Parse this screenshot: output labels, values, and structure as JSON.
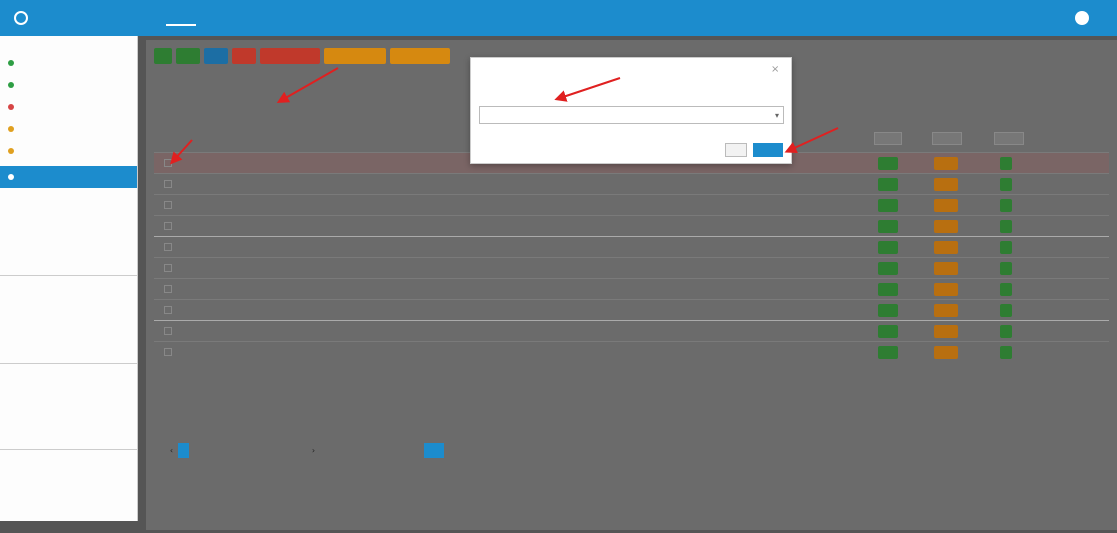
{
  "app": {
    "title": ""
  },
  "topbar": {
    "menu": [
      {
        "label": ""
      },
      {
        "label": ""
      },
      {
        "label": ""
      },
      {
        "label": ""
      },
      {
        "label": ""
      }
    ],
    "user": ""
  },
  "sidebar": {
    "header": "",
    "items": [
      {
        "label": "",
        "color": "#2e9e44"
      },
      {
        "label": "",
        "color": "#2e9e44"
      },
      {
        "label": "",
        "color": "#d64545"
      },
      {
        "label": "",
        "color": "#e0a020"
      },
      {
        "label": "",
        "color": "#e0a020"
      },
      {
        "label": "",
        "color": "#ffffff"
      }
    ],
    "subitems": [
      {
        "label": ""
      },
      {
        "label": ""
      },
      {
        "label": ""
      },
      {
        "label": ""
      },
      {
        "label": ""
      },
      {
        "label": ""
      },
      {
        "label": ""
      },
      {
        "label": ""
      },
      {
        "label": ""
      },
      {
        "label": ""
      },
      {
        "label": ""
      },
      {
        "label": ""
      },
      {
        "label": ""
      },
      {
        "label": ""
      },
      {
        "label": ""
      }
    ]
  },
  "toolbar": {
    "buttons": [
      {
        "label": "",
        "color": "#2e7d32"
      },
      {
        "label": "",
        "color": "#2e7d32"
      },
      {
        "label": "",
        "color": "#1c6ea4"
      },
      {
        "label": "",
        "color": "#c0392b"
      },
      {
        "label": "",
        "color": "#c0392b"
      },
      {
        "label": "",
        "color": "#d68910"
      },
      {
        "label": "",
        "color": "#d68910"
      }
    ]
  },
  "list": {
    "title": "",
    "actions": ""
  },
  "table": {
    "headers": [
      "",
      "",
      "",
      "",
      "",
      "",
      "",
      ""
    ],
    "filters": [
      "",
      "",
      ""
    ],
    "rows": [
      {
        "name": "",
        "date": "",
        "owner": "",
        "flag": "",
        "last": ""
      },
      {
        "name": "",
        "date": "",
        "owner": "",
        "flag": "",
        "last": ""
      },
      {
        "name": "",
        "date": "",
        "owner": "",
        "flag": "",
        "last": ""
      },
      {
        "name": "",
        "date": "",
        "owner": "",
        "flag": "",
        "last": ""
      },
      {
        "name": "",
        "date": "",
        "owner": "",
        "flag": "",
        "last": ""
      },
      {
        "name": "",
        "date": "",
        "owner": "",
        "flag": "",
        "last": ""
      },
      {
        "name": "",
        "date": "",
        "owner": "",
        "flag": "",
        "last": ""
      },
      {
        "name": "",
        "date": "",
        "owner": "",
        "flag": "",
        "last": ""
      },
      {
        "name": "",
        "date": "",
        "owner": "",
        "flag": "",
        "last": ""
      },
      {
        "name": "",
        "date": "",
        "owner": "",
        "flag": "",
        "last": ""
      }
    ]
  },
  "pagination": {
    "pages": [
      "",
      "",
      "",
      "",
      "",
      "",
      "",
      "",
      "",
      ""
    ],
    "total_text": "",
    "go_label": ""
  },
  "modal": {
    "title": "",
    "select_value": "",
    "cancel_label": "",
    "ok_label": ""
  },
  "annotations": {
    "labels": [
      "",
      "",
      ""
    ],
    "arrow_color": "#e02020"
  }
}
